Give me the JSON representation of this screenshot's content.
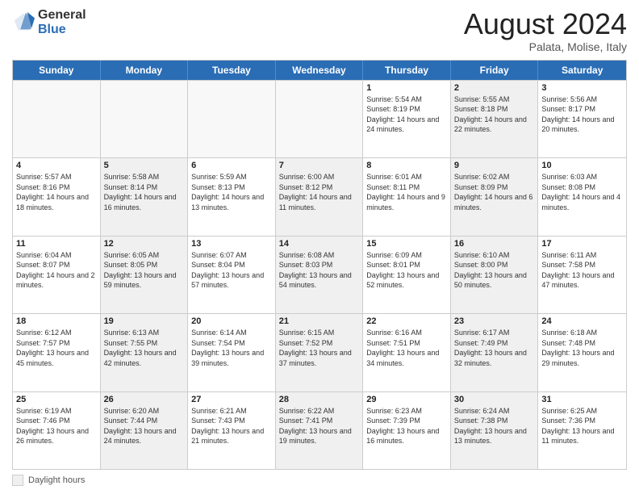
{
  "logo": {
    "general": "General",
    "blue": "Blue"
  },
  "title": "August 2024",
  "subtitle": "Palata, Molise, Italy",
  "days_of_week": [
    "Sunday",
    "Monday",
    "Tuesday",
    "Wednesday",
    "Thursday",
    "Friday",
    "Saturday"
  ],
  "footer_label": "Daylight hours",
  "weeks": [
    [
      {
        "day": "",
        "info": "",
        "empty": true
      },
      {
        "day": "",
        "info": "",
        "empty": true
      },
      {
        "day": "",
        "info": "",
        "empty": true
      },
      {
        "day": "",
        "info": "",
        "empty": true
      },
      {
        "day": "1",
        "info": "Sunrise: 5:54 AM\nSunset: 8:19 PM\nDaylight: 14 hours\nand 24 minutes.",
        "shaded": false
      },
      {
        "day": "2",
        "info": "Sunrise: 5:55 AM\nSunset: 8:18 PM\nDaylight: 14 hours\nand 22 minutes.",
        "shaded": true
      },
      {
        "day": "3",
        "info": "Sunrise: 5:56 AM\nSunset: 8:17 PM\nDaylight: 14 hours\nand 20 minutes.",
        "shaded": false
      }
    ],
    [
      {
        "day": "4",
        "info": "Sunrise: 5:57 AM\nSunset: 8:16 PM\nDaylight: 14 hours\nand 18 minutes.",
        "shaded": false
      },
      {
        "day": "5",
        "info": "Sunrise: 5:58 AM\nSunset: 8:14 PM\nDaylight: 14 hours\nand 16 minutes.",
        "shaded": true
      },
      {
        "day": "6",
        "info": "Sunrise: 5:59 AM\nSunset: 8:13 PM\nDaylight: 14 hours\nand 13 minutes.",
        "shaded": false
      },
      {
        "day": "7",
        "info": "Sunrise: 6:00 AM\nSunset: 8:12 PM\nDaylight: 14 hours\nand 11 minutes.",
        "shaded": true
      },
      {
        "day": "8",
        "info": "Sunrise: 6:01 AM\nSunset: 8:11 PM\nDaylight: 14 hours\nand 9 minutes.",
        "shaded": false
      },
      {
        "day": "9",
        "info": "Sunrise: 6:02 AM\nSunset: 8:09 PM\nDaylight: 14 hours\nand 6 minutes.",
        "shaded": true
      },
      {
        "day": "10",
        "info": "Sunrise: 6:03 AM\nSunset: 8:08 PM\nDaylight: 14 hours\nand 4 minutes.",
        "shaded": false
      }
    ],
    [
      {
        "day": "11",
        "info": "Sunrise: 6:04 AM\nSunset: 8:07 PM\nDaylight: 14 hours\nand 2 minutes.",
        "shaded": false
      },
      {
        "day": "12",
        "info": "Sunrise: 6:05 AM\nSunset: 8:05 PM\nDaylight: 13 hours\nand 59 minutes.",
        "shaded": true
      },
      {
        "day": "13",
        "info": "Sunrise: 6:07 AM\nSunset: 8:04 PM\nDaylight: 13 hours\nand 57 minutes.",
        "shaded": false
      },
      {
        "day": "14",
        "info": "Sunrise: 6:08 AM\nSunset: 8:03 PM\nDaylight: 13 hours\nand 54 minutes.",
        "shaded": true
      },
      {
        "day": "15",
        "info": "Sunrise: 6:09 AM\nSunset: 8:01 PM\nDaylight: 13 hours\nand 52 minutes.",
        "shaded": false
      },
      {
        "day": "16",
        "info": "Sunrise: 6:10 AM\nSunset: 8:00 PM\nDaylight: 13 hours\nand 50 minutes.",
        "shaded": true
      },
      {
        "day": "17",
        "info": "Sunrise: 6:11 AM\nSunset: 7:58 PM\nDaylight: 13 hours\nand 47 minutes.",
        "shaded": false
      }
    ],
    [
      {
        "day": "18",
        "info": "Sunrise: 6:12 AM\nSunset: 7:57 PM\nDaylight: 13 hours\nand 45 minutes.",
        "shaded": false
      },
      {
        "day": "19",
        "info": "Sunrise: 6:13 AM\nSunset: 7:55 PM\nDaylight: 13 hours\nand 42 minutes.",
        "shaded": true
      },
      {
        "day": "20",
        "info": "Sunrise: 6:14 AM\nSunset: 7:54 PM\nDaylight: 13 hours\nand 39 minutes.",
        "shaded": false
      },
      {
        "day": "21",
        "info": "Sunrise: 6:15 AM\nSunset: 7:52 PM\nDaylight: 13 hours\nand 37 minutes.",
        "shaded": true
      },
      {
        "day": "22",
        "info": "Sunrise: 6:16 AM\nSunset: 7:51 PM\nDaylight: 13 hours\nand 34 minutes.",
        "shaded": false
      },
      {
        "day": "23",
        "info": "Sunrise: 6:17 AM\nSunset: 7:49 PM\nDaylight: 13 hours\nand 32 minutes.",
        "shaded": true
      },
      {
        "day": "24",
        "info": "Sunrise: 6:18 AM\nSunset: 7:48 PM\nDaylight: 13 hours\nand 29 minutes.",
        "shaded": false
      }
    ],
    [
      {
        "day": "25",
        "info": "Sunrise: 6:19 AM\nSunset: 7:46 PM\nDaylight: 13 hours\nand 26 minutes.",
        "shaded": false
      },
      {
        "day": "26",
        "info": "Sunrise: 6:20 AM\nSunset: 7:44 PM\nDaylight: 13 hours\nand 24 minutes.",
        "shaded": true
      },
      {
        "day": "27",
        "info": "Sunrise: 6:21 AM\nSunset: 7:43 PM\nDaylight: 13 hours\nand 21 minutes.",
        "shaded": false
      },
      {
        "day": "28",
        "info": "Sunrise: 6:22 AM\nSunset: 7:41 PM\nDaylight: 13 hours\nand 19 minutes.",
        "shaded": true
      },
      {
        "day": "29",
        "info": "Sunrise: 6:23 AM\nSunset: 7:39 PM\nDaylight: 13 hours\nand 16 minutes.",
        "shaded": false
      },
      {
        "day": "30",
        "info": "Sunrise: 6:24 AM\nSunset: 7:38 PM\nDaylight: 13 hours\nand 13 minutes.",
        "shaded": true
      },
      {
        "day": "31",
        "info": "Sunrise: 6:25 AM\nSunset: 7:36 PM\nDaylight: 13 hours\nand 11 minutes.",
        "shaded": false
      }
    ]
  ]
}
